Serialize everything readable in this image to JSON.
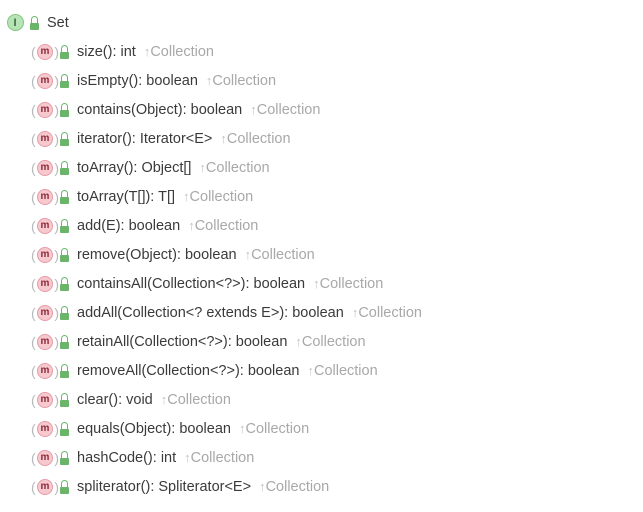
{
  "root": {
    "name": "Set",
    "icon_letter": "I"
  },
  "method_icon_letter": "m",
  "members": [
    {
      "signature": "size(): int",
      "inherited_from": "Collection"
    },
    {
      "signature": "isEmpty(): boolean",
      "inherited_from": "Collection"
    },
    {
      "signature": "contains(Object): boolean",
      "inherited_from": "Collection"
    },
    {
      "signature": "iterator(): Iterator<E>",
      "inherited_from": "Collection"
    },
    {
      "signature": "toArray(): Object[]",
      "inherited_from": "Collection"
    },
    {
      "signature": "toArray(T[]): T[]",
      "inherited_from": "Collection"
    },
    {
      "signature": "add(E): boolean",
      "inherited_from": "Collection"
    },
    {
      "signature": "remove(Object): boolean",
      "inherited_from": "Collection"
    },
    {
      "signature": "containsAll(Collection<?>): boolean",
      "inherited_from": "Collection"
    },
    {
      "signature": "addAll(Collection<? extends E>): boolean",
      "inherited_from": "Collection"
    },
    {
      "signature": "retainAll(Collection<?>): boolean",
      "inherited_from": "Collection"
    },
    {
      "signature": "removeAll(Collection<?>): boolean",
      "inherited_from": "Collection"
    },
    {
      "signature": "clear(): void",
      "inherited_from": "Collection"
    },
    {
      "signature": "equals(Object): boolean",
      "inherited_from": "Collection"
    },
    {
      "signature": "hashCode(): int",
      "inherited_from": "Collection"
    },
    {
      "signature": "spliterator(): Spliterator<E>",
      "inherited_from": "Collection"
    }
  ]
}
